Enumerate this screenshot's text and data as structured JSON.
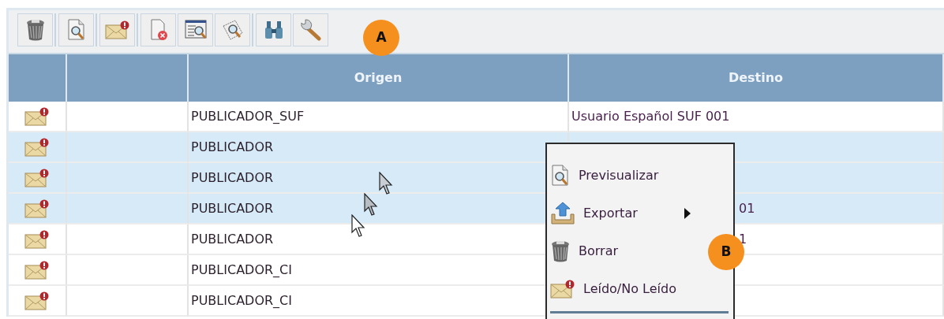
{
  "toolbar": {
    "groups": [
      [
        {
          "kind": "trash"
        }
      ],
      [
        {
          "kind": "preview"
        }
      ],
      [
        {
          "kind": "mail"
        }
      ],
      [
        {
          "kind": "doc-delete"
        },
        {
          "kind": "window-preview"
        },
        {
          "kind": "stamp-preview"
        }
      ],
      [
        {
          "kind": "binoculars"
        },
        {
          "kind": "wrench"
        }
      ]
    ]
  },
  "markers": [
    {
      "label": "A"
    },
    {
      "label": "B"
    }
  ],
  "table": {
    "columns": [
      {},
      {},
      {
        "label": "Origen"
      },
      {
        "label": "Destino"
      }
    ],
    "rows": [
      {
        "selected": false,
        "origen": "PUBLICADOR_SUF",
        "destino": "Usuario Español SUF 001"
      },
      {
        "selected": true,
        "origen": "PUBLICADOR"
      },
      {
        "selected": true,
        "origen": "PUBLICADOR"
      },
      {
        "selected": true,
        "origen": "PUBLICADOR",
        "destino": "01",
        "covered": true
      },
      {
        "selected": false,
        "origen": "PUBLICADOR",
        "destino": "1",
        "covered": true
      },
      {
        "selected": false,
        "origen": "PUBLICADOR_CI"
      },
      {
        "selected": false,
        "origen": "PUBLICADOR_CI"
      }
    ]
  },
  "context_menu": {
    "items": [
      {
        "kind": "preview",
        "label": "Previsualizar",
        "submenu": false
      },
      {
        "kind": "export",
        "label": "Exportar",
        "submenu": true
      },
      {
        "kind": "trash",
        "label": "Borrar",
        "submenu": false
      },
      {
        "kind": "mail",
        "label": "Leído/No Leído",
        "submenu": false
      }
    ]
  }
}
